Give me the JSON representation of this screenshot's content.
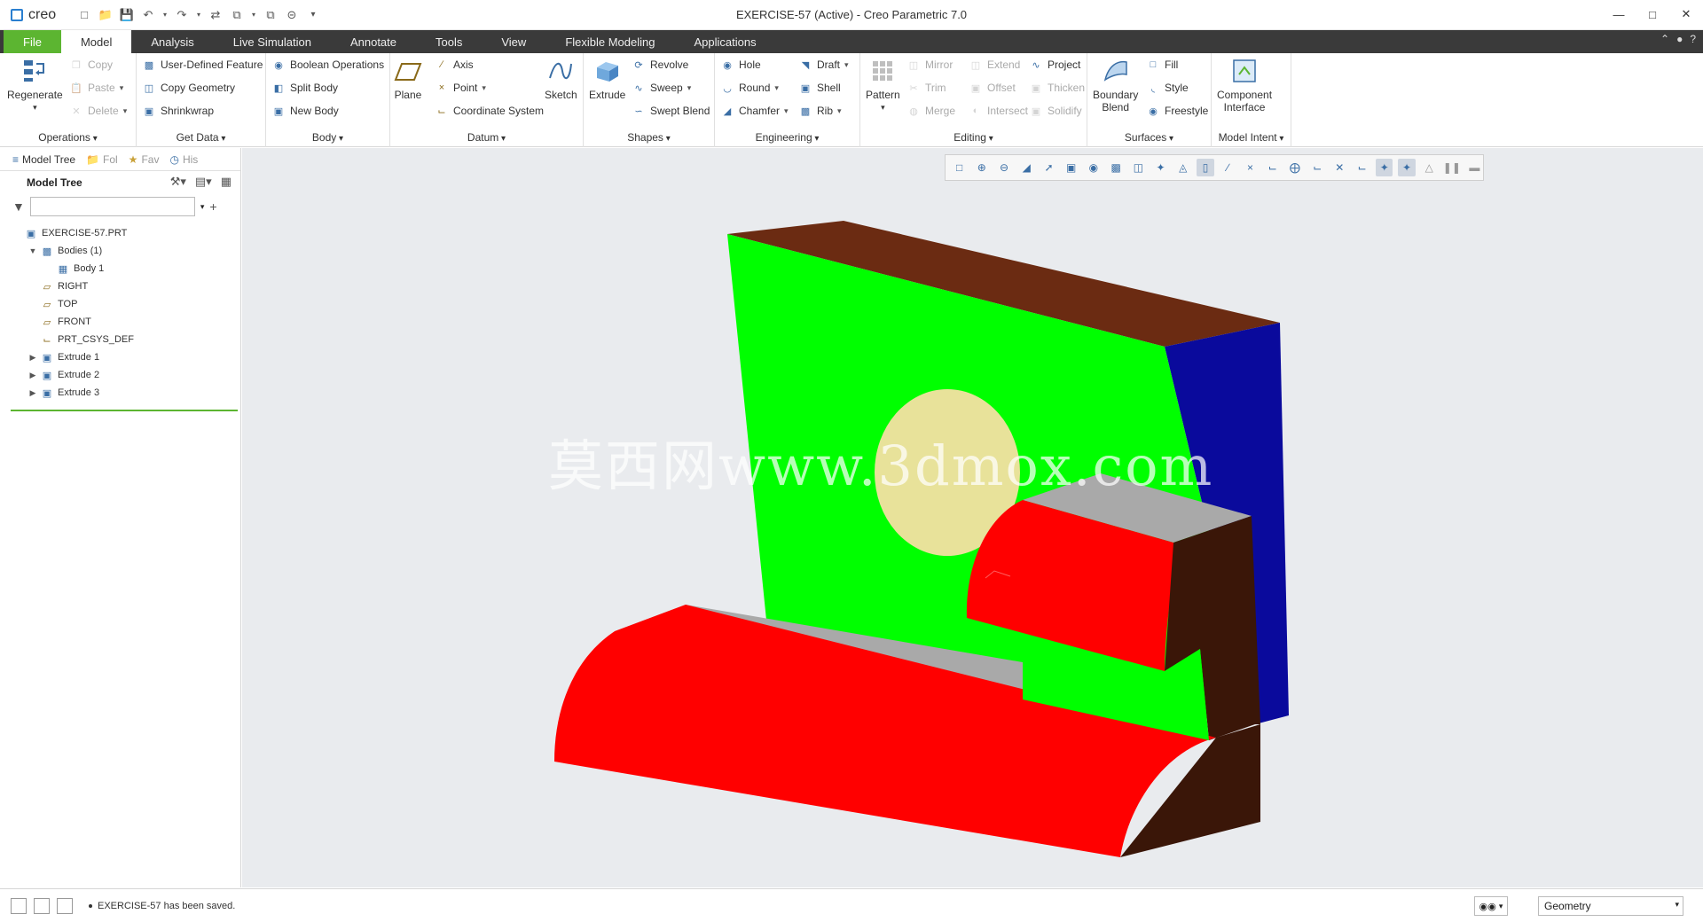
{
  "app": {
    "logo": "creo",
    "window_title": "EXERCISE-57 (Active) - Creo Parametric 7.0"
  },
  "tabs": [
    {
      "label": "File"
    },
    {
      "label": "Model"
    },
    {
      "label": "Analysis"
    },
    {
      "label": "Live Simulation"
    },
    {
      "label": "Annotate"
    },
    {
      "label": "Tools"
    },
    {
      "label": "View"
    },
    {
      "label": "Flexible Modeling"
    },
    {
      "label": "Applications"
    }
  ],
  "ribbon": {
    "operations": {
      "label": "Operations",
      "regenerate": "Regenerate",
      "copy": "Copy",
      "paste": "Paste",
      "delete": "Delete"
    },
    "get_data": {
      "label": "Get Data",
      "user_defined_feature": "User-Defined Feature",
      "copy_geometry": "Copy Geometry",
      "shrinkwrap": "Shrinkwrap"
    },
    "body": {
      "label": "Body",
      "boolean_operations": "Boolean Operations",
      "split_body": "Split Body",
      "new_body": "New Body"
    },
    "datum": {
      "label": "Datum",
      "plane": "Plane",
      "axis": "Axis",
      "point": "Point",
      "coordinate_system": "Coordinate System",
      "sketch": "Sketch"
    },
    "shapes": {
      "label": "Shapes",
      "extrude": "Extrude",
      "revolve": "Revolve",
      "sweep": "Sweep",
      "swept_blend": "Swept Blend"
    },
    "engineering": {
      "label": "Engineering",
      "hole": "Hole",
      "round": "Round",
      "chamfer": "Chamfer",
      "draft": "Draft",
      "shell": "Shell",
      "rib": "Rib"
    },
    "editing": {
      "label": "Editing",
      "pattern": "Pattern",
      "mirror": "Mirror",
      "trim": "Trim",
      "merge": "Merge",
      "extend": "Extend",
      "offset": "Offset",
      "intersect": "Intersect",
      "project": "Project",
      "thicken": "Thicken",
      "solidify": "Solidify"
    },
    "surfaces": {
      "label": "Surfaces",
      "boundary_blend": "Boundary\nBlend",
      "fill": "Fill",
      "style": "Style",
      "freestyle": "Freestyle"
    },
    "model_intent": {
      "label": "Model Intent",
      "component_interface": "Component\nInterface"
    }
  },
  "navigator": {
    "tabs": [
      "Model Tree",
      "Fol",
      "Fav",
      "His"
    ],
    "header": "Model Tree",
    "search_value": ""
  },
  "tree": [
    {
      "label": "EXERCISE-57.PRT",
      "level": 0,
      "expander": ""
    },
    {
      "label": "Bodies (1)",
      "level": 1,
      "expander": "▼"
    },
    {
      "label": "Body 1",
      "level": 2,
      "expander": ""
    },
    {
      "label": "RIGHT",
      "level": 1,
      "expander": ""
    },
    {
      "label": "TOP",
      "level": 1,
      "expander": ""
    },
    {
      "label": "FRONT",
      "level": 1,
      "expander": ""
    },
    {
      "label": "PRT_CSYS_DEF",
      "level": 1,
      "expander": ""
    },
    {
      "label": "Extrude 1",
      "level": 1,
      "expander": "▶"
    },
    {
      "label": "Extrude 2",
      "level": 1,
      "expander": "▶"
    },
    {
      "label": "Extrude 3",
      "level": 1,
      "expander": "▶"
    }
  ],
  "viewport": {
    "watermark": "莫西网www.3dmox.com",
    "colors": {
      "front_face": "#00ff00",
      "top_face": "#6b2b12",
      "side_face": "#0a0a9c",
      "red_face": "#ff0000",
      "grey_face": "#a9a9a9",
      "dark_face": "#3a1608",
      "hole": "#e8e29a"
    }
  },
  "status": {
    "message": "EXERCISE-57 has been saved.",
    "selection_filter": "Geometry"
  },
  "colors": {
    "file_tab": "#5cb531",
    "tabbar": "#3a3a3a",
    "accent": "#3a6ea5"
  }
}
